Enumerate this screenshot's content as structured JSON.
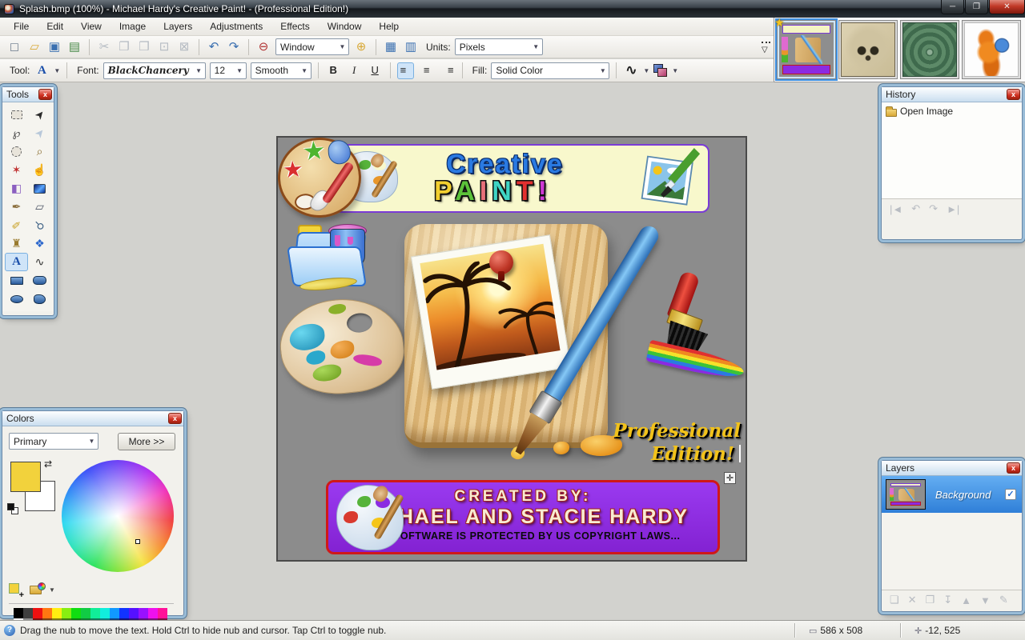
{
  "ui": {
    "close_glyph": "x",
    "caret": "▼"
  },
  "window": {
    "title": "Splash.bmp (100%) - Michael Hardy's Creative Paint! - (Professional Edition!)",
    "buttons": {
      "minimize": "─",
      "restore": "❐",
      "close": "✕"
    }
  },
  "menu": {
    "items": [
      "File",
      "Edit",
      "View",
      "Image",
      "Layers",
      "Adjustments",
      "Effects",
      "Window",
      "Help"
    ]
  },
  "toolbar1": {
    "icons": {
      "new": "◻",
      "open": "▱",
      "save": "▣",
      "print": "▤",
      "cut": "✂",
      "copy": "❐",
      "paste": "❒",
      "crop": "⊡",
      "deselect": "⊠",
      "undo": "↶",
      "redo": "↷",
      "zoom_out": "⊖",
      "zoom_in": "⊕",
      "grid": "▦",
      "ruler": "▥"
    },
    "zoom_mode": "Window",
    "units_label": "Units:",
    "units_value": "Pixels"
  },
  "toolbar2": {
    "tool_label": "Tool:",
    "tool_glyph": "A",
    "font_label": "Font:",
    "font_value": "BlackChancery",
    "size_value": "12",
    "smooth_value": "Smooth",
    "bold": "B",
    "italic": "I",
    "underline": "U",
    "align_glyph": "≡",
    "fill_label": "Fill:",
    "fill_value": "Solid Color",
    "curve_glyph": "∿"
  },
  "tools_palette": {
    "title": "Tools",
    "tools": [
      {
        "name": "rectangle-select",
        "sw": {
          "w": 14,
          "h": 11,
          "r": "2px",
          "bg": "#e8e4da",
          "border": "1px dashed #666"
        }
      },
      {
        "name": "move-tool",
        "glyph": "➤",
        "color": "#2a2a2a",
        "rot": "-50deg"
      },
      {
        "name": "lasso-select",
        "glyph": "℘",
        "color": "#444444"
      },
      {
        "name": "direct-select",
        "glyph": "➤",
        "color": "#b8c8da",
        "rot": "-50deg"
      },
      {
        "name": "ellipse-select",
        "sw": {
          "w": 13,
          "h": 13,
          "r": "50%",
          "bg": "#e8e4da",
          "border": "1px dashed #666"
        }
      },
      {
        "name": "zoom-tool",
        "glyph": "⌕",
        "color": "#8a6d2f"
      },
      {
        "name": "magic-wand",
        "glyph": "✶",
        "color": "#c03030"
      },
      {
        "name": "pan-tool",
        "glyph": "☝",
        "color": "#555555"
      },
      {
        "name": "fill-tool",
        "glyph": "◧",
        "color": "#8b5fc0"
      },
      {
        "name": "gradient-tool",
        "sw": {
          "w": 15,
          "h": 12,
          "r": "2px",
          "bg": "linear-gradient(135deg,#0a1a6e,#5aa8ff 55%,#0a2f8e)",
          "border": "1px solid #334455"
        }
      },
      {
        "name": "brush-tool",
        "glyph": "✒",
        "color": "#8a6d3b"
      },
      {
        "name": "eraser-tool",
        "glyph": "▱",
        "color": "#505868"
      },
      {
        "name": "pencil-tool",
        "glyph": "✏",
        "color": "#c9a227",
        "rot": "-40deg"
      },
      {
        "name": "eyedropper-tool",
        "glyph": "⚲",
        "color": "#446688",
        "rot": "135deg"
      },
      {
        "name": "stamp-tool",
        "glyph": "♜",
        "color": "#9a7b2f"
      },
      {
        "name": "color-replace-tool",
        "glyph": "❖",
        "color": "#2a66cc"
      },
      {
        "name": "text-tool",
        "glyph": "A",
        "color": "#1b4faa",
        "selected": true
      },
      {
        "name": "line-curve-tool",
        "glyph": "∿",
        "color": "#333333"
      },
      {
        "name": "rectangle-shape",
        "sw": {
          "w": 16,
          "h": 10,
          "r": "1px",
          "bg": "linear-gradient(180deg,#7aa7d9,#2a5a9a)",
          "border": "1px solid #16304e"
        }
      },
      {
        "name": "rounded-rectangle-shape",
        "sw": {
          "w": 17,
          "h": 11,
          "r": "5px",
          "bg": "linear-gradient(180deg,#7aa7d9,#2a5a9a)",
          "border": "1px solid #16304e"
        }
      },
      {
        "name": "ellipse-shape",
        "sw": {
          "w": 16,
          "h": 10,
          "r": "50%",
          "bg": "linear-gradient(180deg,#7aa7d9,#2a5a9a)",
          "border": "1px solid #16304e"
        }
      },
      {
        "name": "freeform-shape",
        "sw": {
          "w": 15,
          "h": 12,
          "r": "40% 60% 55% 45%",
          "bg": "linear-gradient(180deg,#7aa7d9,#2a5a9a)",
          "border": "1px solid #16304e"
        }
      }
    ]
  },
  "history_palette": {
    "title": "History",
    "items": [
      {
        "label": "Open Image"
      }
    ],
    "nav": [
      {
        "name": "history-first",
        "glyph": "|◄"
      },
      {
        "name": "history-undo",
        "glyph": "↶"
      },
      {
        "name": "history-redo",
        "glyph": "↷"
      },
      {
        "name": "history-last",
        "glyph": "►|"
      }
    ]
  },
  "colors_palette": {
    "title": "Colors",
    "mode_value": "Primary",
    "more_label": "More >>",
    "primary_color": "#f2d23c",
    "secondary_color": "#ffffff",
    "swap_glyph": "⇄",
    "strip_top": [
      "#000000",
      "#3f3f3f",
      "#ee1111",
      "#ff7711",
      "#ffee11",
      "#88ee11",
      "#11dd11",
      "#11cc44",
      "#11ee99",
      "#11eedd",
      "#1199ff",
      "#1133ff",
      "#5511ff",
      "#9911ff",
      "#ee11ee",
      "#ff1199"
    ],
    "strip_bottom": [
      "#ffffff",
      "#8f8f8f",
      "#7a0f0f",
      "#7a3f0f",
      "#7a7a0f",
      "#3f7a0f",
      "#0f7a0f",
      "#0f7a2f",
      "#0f7a5a",
      "#0f7a7a",
      "#0f3f7a",
      "#0f0f7a",
      "#2f0f7a",
      "#5a0f7a",
      "#7a0f7a",
      "#7a0f3f"
    ]
  },
  "layers_palette": {
    "title": "Layers",
    "layers": [
      {
        "name": "Background",
        "visible": true,
        "check_glyph": "✓"
      }
    ],
    "footer": [
      {
        "name": "add-layer",
        "glyph": "❏"
      },
      {
        "name": "delete-layer",
        "glyph": "✕"
      },
      {
        "name": "duplicate-layer",
        "glyph": "❐"
      },
      {
        "name": "merge-layer-down",
        "glyph": "↧"
      },
      {
        "name": "move-layer-up",
        "glyph": "▲"
      },
      {
        "name": "move-layer-down",
        "glyph": "▼"
      },
      {
        "name": "layer-properties",
        "glyph": "✎"
      }
    ]
  },
  "canvas": {
    "top_banner": {
      "word": "Creative",
      "paint_letters": [
        {
          "ch": "P",
          "color": "#f2cf2f"
        },
        {
          "ch": "A",
          "color": "#5cc23a"
        },
        {
          "ch": "I",
          "color": "#e8707a"
        },
        {
          "ch": "N",
          "color": "#3ed4c4"
        },
        {
          "ch": "T",
          "color": "#e23030"
        },
        {
          "ch": "!",
          "color": "#cf3ad4"
        }
      ]
    },
    "edition_line1": "Professional",
    "edition_line2": "Edition!",
    "bottom_banner": {
      "line1": "CREATED BY:",
      "line2": "MICHAEL AND STACIE HARDY",
      "line3": "THIS SOFTWARE IS PROTECTED BY US COPYRIGHT LAWS..."
    }
  },
  "status_bar": {
    "help_glyph": "?",
    "message": "Drag the nub to move the text. Hold Ctrl to hide nub and cursor. Tap Ctrl to toggle nub.",
    "dimensions_icon": "▭",
    "dimensions": "586 x 508",
    "position_icon": "✛",
    "position": "-12, 525"
  }
}
